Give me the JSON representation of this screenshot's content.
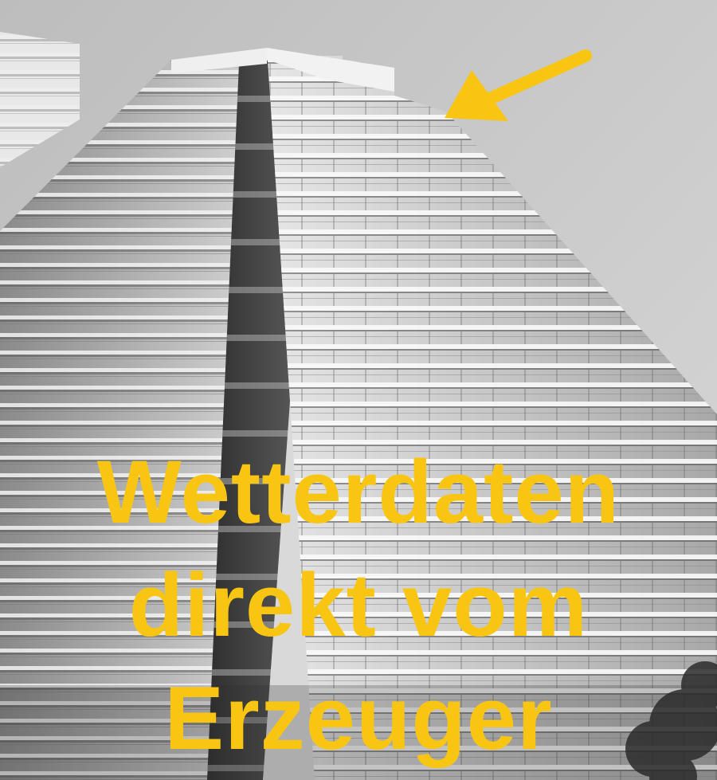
{
  "colors": {
    "accent": "#f9c513",
    "sky": "#cfcfcf",
    "facade_light": "#e4e4e4",
    "facade_mid": "#9a9a9a",
    "facade_dark": "#3a3a3a"
  },
  "headline": {
    "line1": "Wetterdaten",
    "line2": "direkt vom",
    "line3": "Erzeuger"
  },
  "icons": {
    "arrow": "arrow-pointing-down-left-icon"
  }
}
